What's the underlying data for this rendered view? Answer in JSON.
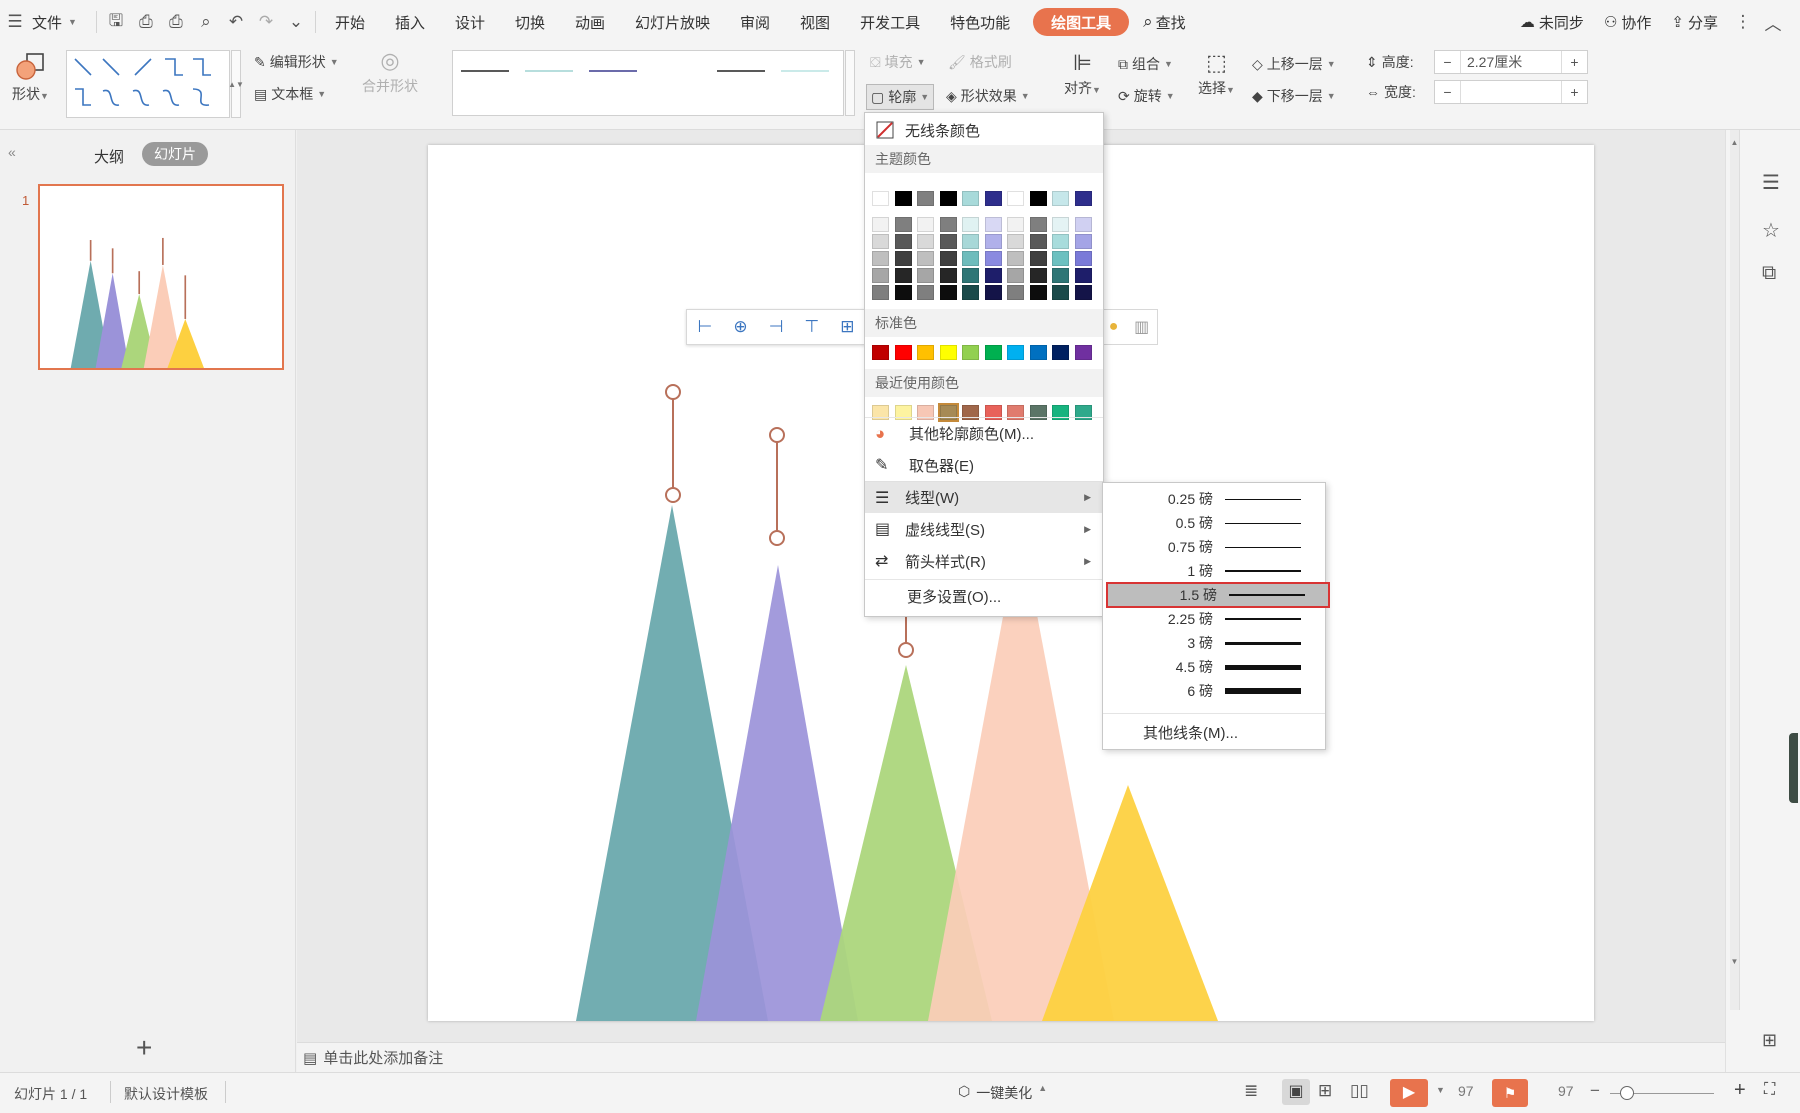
{
  "menubar": {
    "file_label": "文件",
    "tabs": [
      "开始",
      "插入",
      "设计",
      "切换",
      "动画",
      "幻灯片放映",
      "审阅",
      "视图",
      "开发工具",
      "特色功能"
    ],
    "active_tab": "绘图工具",
    "search_label": "查找",
    "sync_label": "未同步",
    "collab_label": "协作",
    "share_label": "分享"
  },
  "ribbon": {
    "shape_label": "形状",
    "edit_shape_label": "编辑形状",
    "textbox_label": "文本框",
    "merge_shape_label": "合并形状",
    "fill_label": "填充",
    "format_brush_label": "格式刷",
    "outline_label": "轮廓",
    "shape_effect_label": "形状效果",
    "align_label": "对齐",
    "group_label": "组合",
    "rotate_label": "旋转",
    "select_label": "选择",
    "bring_forward_label": "上移一层",
    "send_backward_label": "下移一层",
    "height_label": "高度:",
    "height_value": "2.27厘米",
    "width_label": "宽度:",
    "width_value": "",
    "minus": "−",
    "plus": "+",
    "line_styles": [
      {
        "color": "#222222"
      },
      {
        "color": "#9fd3d2"
      },
      {
        "color": "#3a3a8e"
      },
      {
        "color": "#ffffff"
      },
      {
        "color": "#222222"
      },
      {
        "color": "#b9e3e2"
      }
    ]
  },
  "leftpanel": {
    "tab_outline": "大纲",
    "tab_slides": "幻灯片",
    "slide_number": "1",
    "add_icon": "+"
  },
  "outline_menu": {
    "no_line": "无线条颜色",
    "theme_colors_title": "主题颜色",
    "standard_colors_title": "标准色",
    "recent_colors_title": "最近使用颜色",
    "theme_top_row": [
      "#ffffff",
      "#000000",
      "#808080",
      "#000000",
      "#a8dada",
      "#2e2e8c",
      "#ffffff",
      "#000000",
      "#c6e7ea",
      "#2e2e8c"
    ],
    "theme_shades": [
      [
        "#f2f2f2",
        "#7f7f7f",
        "#f2f2f2",
        "#7f7f7f",
        "#e0f2f2",
        "#d8d8f4",
        "#f2f2f2",
        "#7f7f7f",
        "#e4f3f4",
        "#d0d0f2"
      ],
      [
        "#d9d9d9",
        "#595959",
        "#d9d9d9",
        "#595959",
        "#a8d8d8",
        "#b0b0ea",
        "#d9d9d9",
        "#595959",
        "#a8dcdc",
        "#a4a4e6"
      ],
      [
        "#bfbfbf",
        "#3f3f3f",
        "#bfbfbf",
        "#3f3f3f",
        "#6ebcbc",
        "#8a8ae0",
        "#bfbfbf",
        "#3f3f3f",
        "#6cc0c0",
        "#7a7ad8"
      ],
      [
        "#a6a6a6",
        "#262626",
        "#a6a6a6",
        "#262626",
        "#2e7676",
        "#1e1e6a",
        "#a6a6a6",
        "#262626",
        "#2e7676",
        "#1e1e6a"
      ],
      [
        "#7f7f7f",
        "#0d0d0d",
        "#7f7f7f",
        "#0d0d0d",
        "#1a4a4a",
        "#141448",
        "#7f7f7f",
        "#0d0d0d",
        "#1a4a4a",
        "#141448"
      ]
    ],
    "standard": [
      "#c00000",
      "#ff0000",
      "#ffc000",
      "#ffff00",
      "#92d050",
      "#00b050",
      "#00b0f0",
      "#0070c0",
      "#002060",
      "#7030a0"
    ],
    "recent": [
      "#fbe5a8",
      "#fdf3a0",
      "#f7c7b5",
      "#a68a55",
      "#a0674a",
      "#e8625a",
      "#e07b6e",
      "#5b7567",
      "#17b37f",
      "#2fa98b"
    ],
    "more_colors": "其他轮廓颜色(M)...",
    "eyedropper": "取色器(E)",
    "line_type": "线型(W)",
    "dash_type": "虚线线型(S)",
    "arrow_style": "箭头样式(R)",
    "more_settings": "更多设置(O)..."
  },
  "lineweight_menu": {
    "weights": [
      {
        "label": "0.25 磅",
        "w": 1
      },
      {
        "label": "0.5 磅",
        "w": 1
      },
      {
        "label": "0.75 磅",
        "w": 1
      },
      {
        "label": "1 磅",
        "w": 1.5
      },
      {
        "label": "1.5 磅",
        "w": 2
      },
      {
        "label": "2.25 磅",
        "w": 2.5
      },
      {
        "label": "3 磅",
        "w": 3
      },
      {
        "label": "4.5 磅",
        "w": 5
      },
      {
        "label": "6 磅",
        "w": 6
      }
    ],
    "selected": "1.5 磅",
    "other_lines": "其他线条(M)..."
  },
  "notes": {
    "placeholder": "单击此处添加备注"
  },
  "status": {
    "slide_info": "幻灯片 1 / 1",
    "template": "默认设计模板",
    "beautify": "一键美化",
    "zoom_a": "97",
    "zoom_b": "97"
  },
  "colors": {
    "accent": "#e8734d",
    "highlight_border": "#d83434",
    "arrow": "#b8705a"
  }
}
